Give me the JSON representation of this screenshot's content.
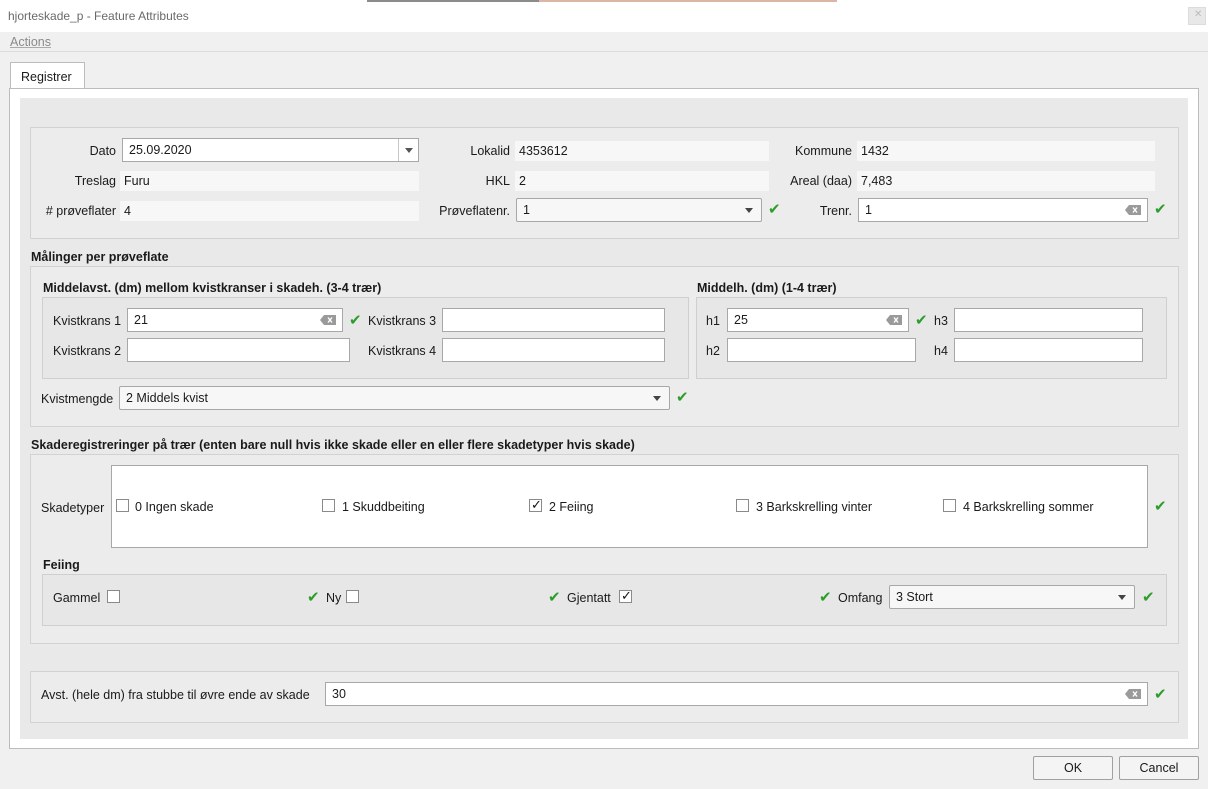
{
  "window": {
    "title": "hjorteskade_p - Feature Attributes",
    "menu_actions": "Actions",
    "tab": "Registrer"
  },
  "top": {
    "dato_label": "Dato",
    "dato_value": "25.09.2020",
    "lokalid_label": "Lokalid",
    "lokalid_value": "4353612",
    "kommune_label": "Kommune",
    "kommune_value": "1432",
    "treslag_label": "Treslag",
    "treslag_value": "Furu",
    "hkl_label": "HKL",
    "hkl_value": "2",
    "areal_label": "Areal (daa)",
    "areal_value": "7,483",
    "provflater_label": "# prøveflater",
    "provflater_value": "4",
    "proveflatenr_label": "Prøveflatenr.",
    "proveflatenr_value": "1",
    "trenr_label": "Trenr.",
    "trenr_value": "1"
  },
  "malinger": {
    "title": "Målinger per prøveflate",
    "kvist_title": "Middelavst. (dm) mellom kvistkranser i skadeh. (3-4 trær)",
    "kk1_label": "Kvistkrans 1",
    "kk1_value": "21",
    "kk2_label": "Kvistkrans 2",
    "kk2_value": "",
    "kk3_label": "Kvistkrans 3",
    "kk3_value": "",
    "kk4_label": "Kvistkrans 4",
    "kk4_value": "",
    "middelh_title": "Middelh. (dm) (1-4 trær)",
    "h1_label": "h1",
    "h1_value": "25",
    "h2_label": "h2",
    "h2_value": "",
    "h3_label": "h3",
    "h3_value": "",
    "h4_label": "h4",
    "h4_value": "",
    "kvistmengde_label": "Kvistmengde",
    "kvistmengde_value": "2 Middels kvist"
  },
  "skade": {
    "title": "Skaderegistreringer på trær (enten bare null hvis ikke skade eller en eller flere skadetyper hvis skade)",
    "skadetyper_label": "Skadetyper",
    "types": [
      {
        "label": "0 Ingen skade",
        "checked": false
      },
      {
        "label": "1 Skuddbeiting",
        "checked": false
      },
      {
        "label": "2 Feiing",
        "checked": true
      },
      {
        "label": "3 Barkskrelling vinter",
        "checked": false
      },
      {
        "label": "4 Barkskrelling sommer",
        "checked": false
      }
    ],
    "feiing_title": "Feiing",
    "gammel_label": "Gammel",
    "gammel_checked": false,
    "ny_label": "Ny",
    "ny_checked": false,
    "gjentatt_label": "Gjentatt",
    "gjentatt_checked": true,
    "omfang_label": "Omfang",
    "omfang_value": "3 Stort"
  },
  "avst": {
    "label": "Avst. (hele dm) fra stubbe til øvre ende av skade",
    "value": "30"
  },
  "buttons": {
    "ok": "OK",
    "cancel": "Cancel"
  },
  "colors": {
    "check": "#2b9d2b",
    "panel": "#ececec",
    "background": "#f0f0f0"
  }
}
